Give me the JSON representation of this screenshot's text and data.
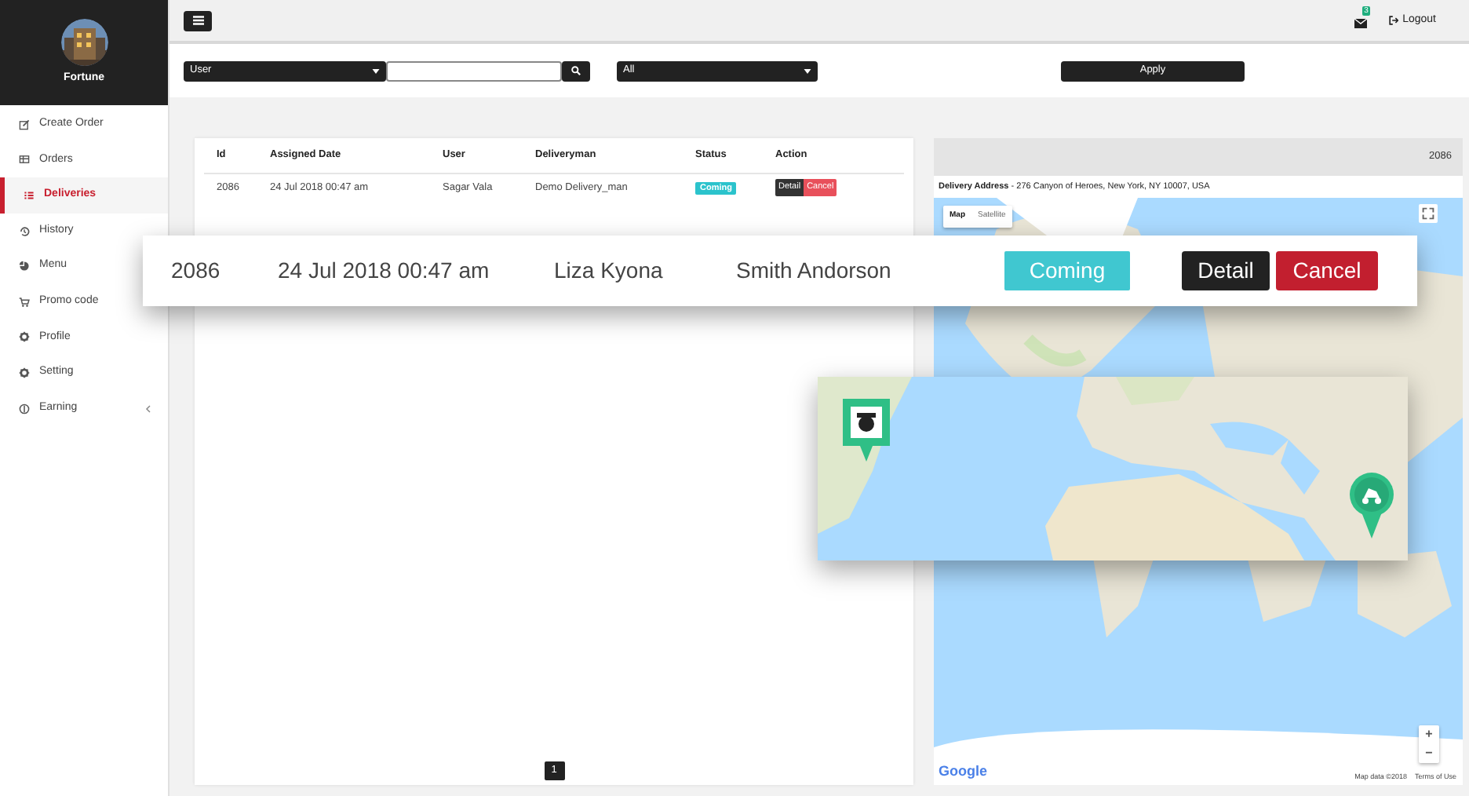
{
  "sidebar": {
    "profile_name": "Fortune",
    "items": [
      {
        "label": "Create Order",
        "selected": false,
        "has_submenu": false
      },
      {
        "label": "Orders",
        "selected": false,
        "has_submenu": false
      },
      {
        "label": "Deliveries",
        "selected": true,
        "has_submenu": false
      },
      {
        "label": "History",
        "selected": false,
        "has_submenu": false
      },
      {
        "label": "Menu",
        "selected": false,
        "has_submenu": false
      },
      {
        "label": "Promo code",
        "selected": false,
        "has_submenu": false
      },
      {
        "label": "Profile",
        "selected": false,
        "has_submenu": false
      },
      {
        "label": "Setting",
        "selected": false,
        "has_submenu": false
      },
      {
        "label": "Earning",
        "selected": false,
        "has_submenu": true
      }
    ]
  },
  "topbar": {
    "notification_count": "3",
    "logout": "Logout"
  },
  "filters": {
    "user_select": "User",
    "status_select": "All",
    "apply": "Apply"
  },
  "table": {
    "columns": [
      "Id",
      "Assigned Date",
      "User",
      "Deliveryman",
      "Status",
      "Action"
    ],
    "rows": [
      {
        "id": "2086",
        "assigned_date": "24 Jul 2018 00:47 am",
        "user": "Sagar Vala",
        "deliveryman": "Demo Delivery_man",
        "status": "Coming",
        "actions": [
          {
            "label": "Detail",
            "kind": "detail"
          },
          {
            "label": "Cancel",
            "kind": "cancel"
          }
        ]
      }
    ],
    "pagination": [
      {
        "label": "1",
        "selected": true
      }
    ]
  },
  "map_panel": {
    "order_id": "2086",
    "address": "**Delivery Address** - 276 Canyon of Heroes, New York, NY 10007, USA",
    "map_types": [
      {
        "label": "Map",
        "selected": true
      },
      {
        "label": "Satellite",
        "selected": false
      }
    ],
    "zoom": [
      "+",
      "−"
    ],
    "logo": "Google",
    "attribution": "Map data ©2018",
    "terms": "Terms of Use"
  },
  "highlight_card": {
    "id": "2086",
    "assigned_date": "24 Jul 2018 00:47 am",
    "user": "Liza Kyona",
    "deliveryman": "Smith Andorson",
    "status": "Coming",
    "actions": [
      {
        "label": "Detail",
        "kind": "detail"
      },
      {
        "label": "Cancel",
        "kind": "cancel"
      }
    ]
  }
}
